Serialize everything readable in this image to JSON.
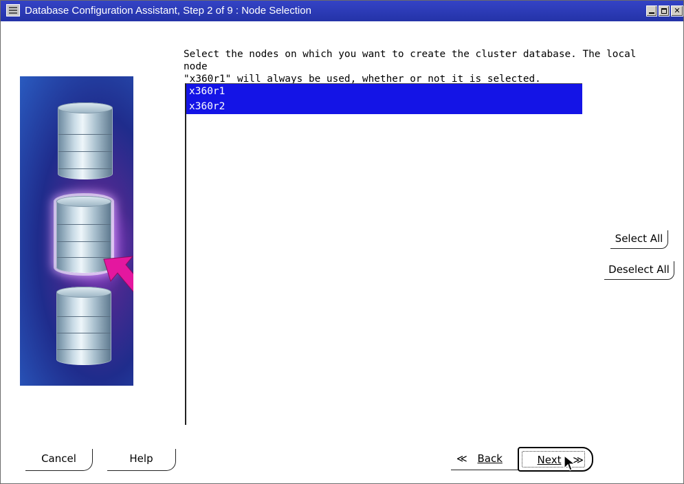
{
  "window": {
    "title": "Database Configuration Assistant, Step 2 of 9 : Node Selection"
  },
  "instruction": "Select the nodes on which you want to create the cluster database. The local node\n\"x360r1\" will always be used, whether or not it is selected.",
  "nodes": [
    {
      "name": "x360r1",
      "selected": true
    },
    {
      "name": "x360r2",
      "selected": true
    }
  ],
  "buttons": {
    "select_all": "Select All",
    "deselect_all": "Deselect All",
    "cancel": "Cancel",
    "help": "Help",
    "back": "Back",
    "next": "Next"
  },
  "icons": {
    "system_menu": "system-menu-icon",
    "minimize": "minimize-icon",
    "maximize": "maximize-icon",
    "close": "close-icon",
    "back": "double-chevron-left-icon",
    "next": "double-chevron-right-icon",
    "cursor": "mouse-pointer-icon"
  },
  "colors": {
    "titlebar": "#2e3ab7",
    "selection": "#1414e6",
    "arrow": "#e4179f"
  }
}
